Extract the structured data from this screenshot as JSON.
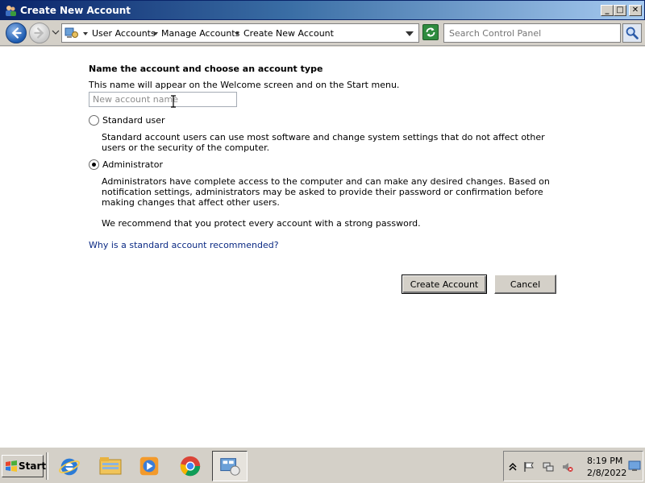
{
  "window": {
    "title": "Create New Account",
    "buttons": {
      "minimize": "_",
      "maximize": "□",
      "close": "✕"
    }
  },
  "navigation": {
    "breadcrumbs": [
      "User Accounts",
      "Manage Accounts",
      "Create New Account"
    ],
    "search_placeholder": "Search Control Panel",
    "icons": [
      "back-icon",
      "forward-icon",
      "control-panel-icon",
      "refresh-icon",
      "search-icon"
    ]
  },
  "form": {
    "heading": "Name the account and choose an account type",
    "subtext": "This name will appear on the Welcome screen and on the Start menu.",
    "name_placeholder": "New account name",
    "name_value": "",
    "options": [
      {
        "label": "Standard user",
        "description": "Standard account users can use most software and change system settings that do not affect other users or the security of the computer.",
        "selected": false
      },
      {
        "label": "Administrator",
        "description": "Administrators have complete access to the computer and can make any desired changes. Based on notification settings, administrators may be asked to provide their password or confirmation before making changes that affect other users.",
        "selected": true
      }
    ],
    "recommendation": "We recommend that you protect every account with a strong password.",
    "help_link": "Why is a standard account recommended?",
    "create_button": "Create Account",
    "cancel_button": "Cancel"
  },
  "taskbar": {
    "start_label": "Start",
    "apps": [
      "internet-explorer-icon",
      "file-explorer-icon",
      "media-player-icon",
      "chrome-icon",
      "control-panel-icon"
    ],
    "clock_time": "8:19 PM",
    "clock_date": "2/8/2022"
  },
  "colors": {
    "titlebar_start": "#0a246a",
    "titlebar_end": "#a6caf0",
    "link": "#0b2a84",
    "chrome": "#d4d0c8"
  }
}
